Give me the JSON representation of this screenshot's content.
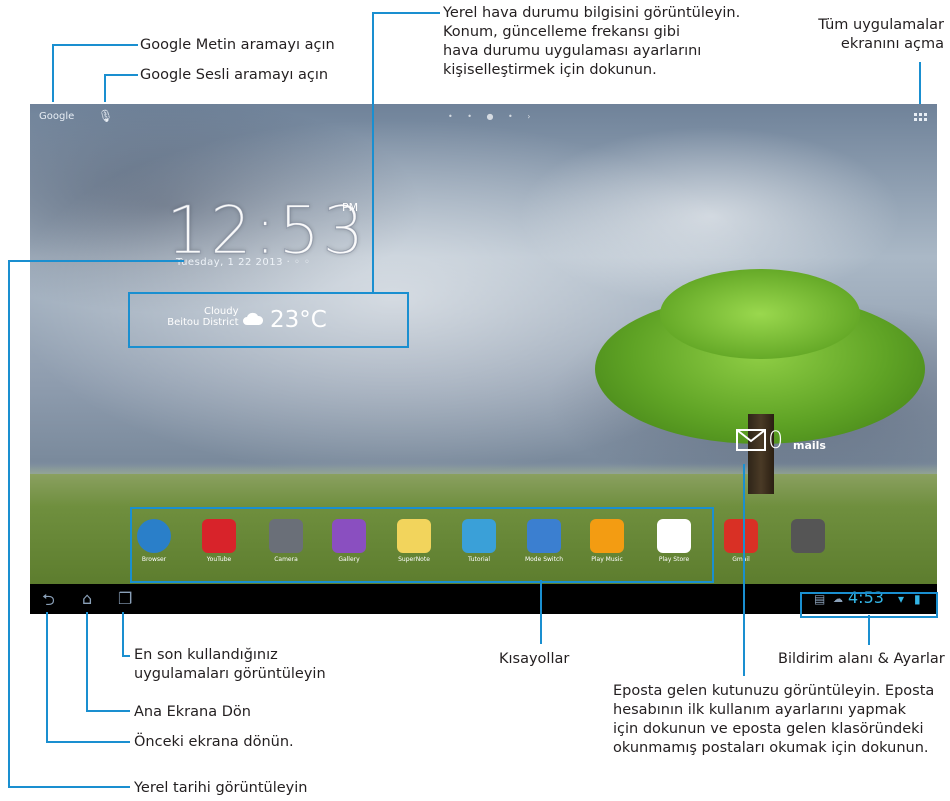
{
  "callouts": {
    "google_text_search": "Google Metin aramayı açın",
    "google_voice_search": "Google Sesli aramayı açın",
    "weather": [
      "Yerel hava durumu bilgisini görüntüleyin.",
      "Konum, güncelleme frekansı gibi",
      "hava durumu uygulaması ayarlarını",
      "kişiselleştirmek için dokunun."
    ],
    "all_apps": [
      "Tüm uygulamalar",
      "ekranını açma"
    ],
    "recent_apps": [
      "En son kullandığınız",
      "uygulamaları görüntüleyin"
    ],
    "home": "Ana Ekrana Dön",
    "back": "Önceki ekrana dönün.",
    "local_date": "Yerel tarihi görüntüleyin",
    "shortcuts": "Kısayollar",
    "notification": "Bildirim alanı & Ayarlar",
    "email": [
      "Eposta gelen kutunuzu görüntüleyin. Eposta",
      "hesabının ilk kullanım ayarlarını yapmak",
      "için dokunun ve eposta gelen klasöründeki",
      "okunmamış postaları okumak için dokunun."
    ]
  },
  "screen": {
    "google_label": "Google",
    "clock": {
      "time": "12:53",
      "ampm": "PM",
      "date": "Tuesday, 1 22 2013  ·  ◦ ◦"
    },
    "weather": {
      "condition": "Cloudy",
      "location": "Beitou District",
      "temp": "23°C"
    },
    "mail": {
      "count": "0",
      "label": "mails"
    },
    "dock": [
      {
        "label": "Browser",
        "color": "#2a7fc9",
        "icon": "globe-icon"
      },
      {
        "label": "YouTube",
        "color": "#d8232a",
        "icon": "youtube-icon"
      },
      {
        "label": "Camera",
        "color": "#6a6f78",
        "icon": "camera-icon"
      },
      {
        "label": "Gallery",
        "color": "#8a4fc0",
        "icon": "gallery-icon"
      },
      {
        "label": "SuperNote",
        "color": "#f2d45c",
        "icon": "notepad-icon"
      },
      {
        "label": "Tutorial",
        "color": "#3aa0d8",
        "icon": "tutorial-icon"
      },
      {
        "label": "Mode Switch",
        "color": "#3b7fd0",
        "icon": "mode-switch-icon"
      },
      {
        "label": "Play Music",
        "color": "#f39c12",
        "icon": "headphones-icon"
      },
      {
        "label": "Play Store",
        "color": "#ffffff",
        "icon": "play-store-icon"
      },
      {
        "label": "Gmail",
        "color": "#d93025",
        "icon": "gmail-icon"
      },
      {
        "label": "",
        "color": "#555555",
        "icon": "app-icon"
      }
    ],
    "status_time": "4:53"
  },
  "colors": {
    "accent": "#1a8fd0",
    "status": "#33b5e5"
  }
}
